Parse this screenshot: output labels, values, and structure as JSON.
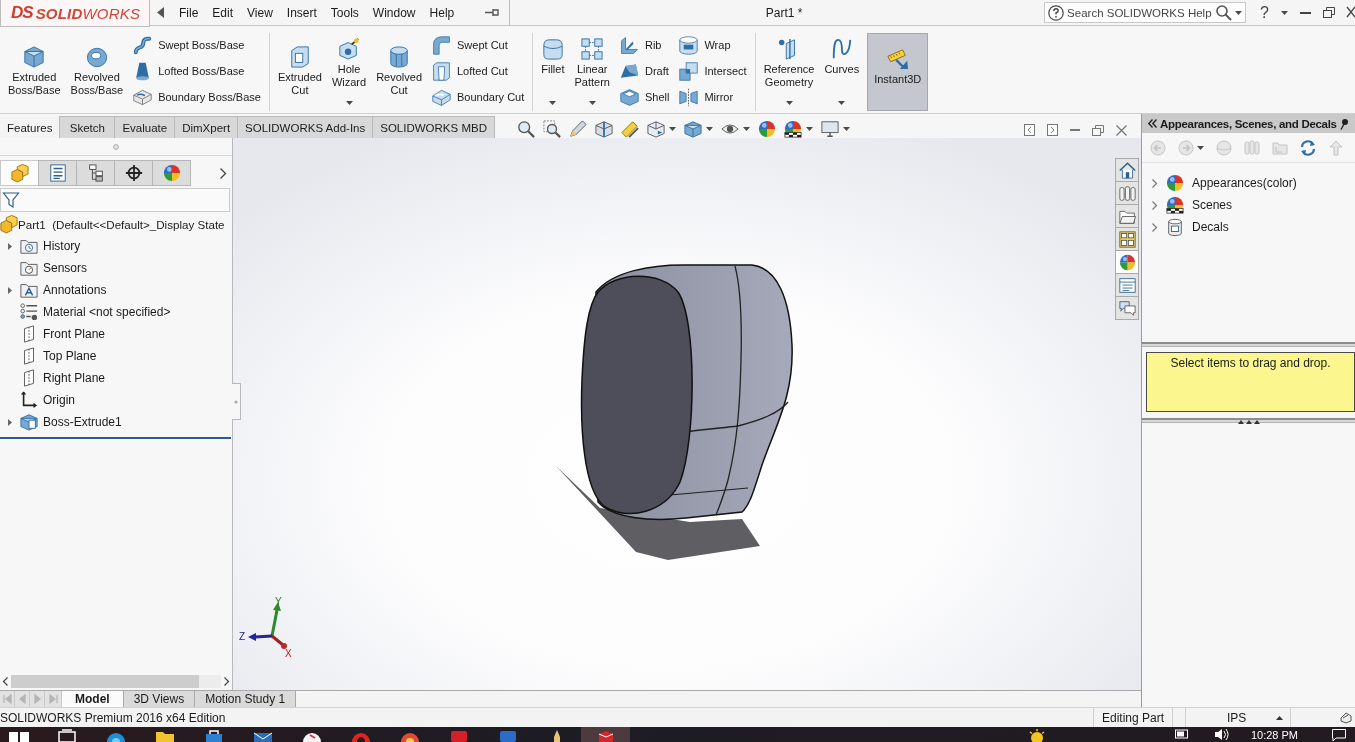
{
  "title_bar": {
    "logo": {
      "mark": "DS",
      "wordmark": "**SOLID**WORKS"
    },
    "menus": [
      "File",
      "Edit",
      "View",
      "Insert",
      "Tools",
      "Window",
      "Help"
    ],
    "document_title": "Part1 *",
    "search": {
      "placeholder": "Search SOLIDWORKS Help"
    },
    "help_glyph": "?"
  },
  "ribbon": {
    "groups": [
      {
        "items": [
          {
            "kind": "large",
            "label": "Extruded Boss/Base",
            "dropdown": false,
            "on": false
          },
          {
            "kind": "large",
            "label": "Revolved Boss/Base",
            "dropdown": false,
            "on": false
          },
          {
            "kind": "stack",
            "items": [
              "Swept Boss/Base",
              "Lofted Boss/Base",
              "Boundary Boss/Base"
            ]
          }
        ]
      },
      {
        "items": [
          {
            "kind": "large",
            "label": "Extruded Cut",
            "dropdown": false,
            "on": false
          },
          {
            "kind": "large",
            "label": "Hole Wizard",
            "dropdown": true,
            "on": false
          },
          {
            "kind": "large",
            "label": "Revolved Cut",
            "dropdown": false,
            "on": false
          },
          {
            "kind": "stack",
            "items": [
              "Swept Cut",
              "Lofted Cut",
              "Boundary Cut"
            ]
          }
        ]
      },
      {
        "items": [
          {
            "kind": "large",
            "label": "Fillet",
            "dropdown": true,
            "on": false
          },
          {
            "kind": "large",
            "label": "Linear Pattern",
            "dropdown": true,
            "on": false
          },
          {
            "kind": "stack",
            "items": [
              "Rib",
              "Draft",
              "Shell"
            ]
          },
          {
            "kind": "stack",
            "items": [
              "Wrap",
              "Intersect",
              "Mirror"
            ]
          }
        ]
      },
      {
        "items": [
          {
            "kind": "large",
            "label": "Reference Geometry",
            "dropdown": true,
            "on": false
          },
          {
            "kind": "large",
            "label": "Curves",
            "dropdown": true,
            "on": false
          },
          {
            "kind": "large",
            "label": "Instant3D",
            "dropdown": false,
            "on": true
          }
        ]
      }
    ]
  },
  "command_tabs": [
    {
      "label": "Features",
      "selected": true
    },
    {
      "label": "Sketch",
      "selected": false
    },
    {
      "label": "Evaluate",
      "selected": false
    },
    {
      "label": "DimXpert",
      "selected": false
    },
    {
      "label": "SOLIDWORKS Add-Ins",
      "selected": false
    },
    {
      "label": "SOLIDWORKS MBD",
      "selected": false
    }
  ],
  "feature_manager": {
    "tabs": [
      {
        "selected": true
      },
      {
        "selected": false
      },
      {
        "selected": false
      },
      {
        "selected": false
      },
      {
        "selected": false
      }
    ],
    "root": "Part1  (Default<<Default>_Display State",
    "items": [
      {
        "kind": "history",
        "label": "History",
        "expandable": true
      },
      {
        "kind": "sensors",
        "label": "Sensors",
        "expandable": false
      },
      {
        "kind": "annotations",
        "label": "Annotations",
        "expandable": true
      },
      {
        "kind": "material",
        "label": "Material <not specified>",
        "expandable": false
      },
      {
        "kind": "plane",
        "label": "Front Plane",
        "expandable": false
      },
      {
        "kind": "plane",
        "label": "Top Plane",
        "expandable": false
      },
      {
        "kind": "plane",
        "label": "Right Plane",
        "expandable": false
      },
      {
        "kind": "origin",
        "label": "Origin",
        "expandable": false
      },
      {
        "kind": "feature",
        "label": "Boss-Extrude1",
        "expandable": true
      }
    ]
  },
  "viewport": {
    "triad": {
      "y": "Y",
      "z": "Z",
      "x": "X"
    }
  },
  "task_pane": {
    "tabs": [
      {
        "selected": false
      },
      {
        "selected": false
      },
      {
        "selected": false
      },
      {
        "selected": false
      },
      {
        "selected": true
      },
      {
        "selected": false
      },
      {
        "selected": false
      }
    ],
    "title": "Appearances, Scenes, and Decals",
    "toolbar": [
      {
        "disabled": true
      },
      {
        "disabled": true
      },
      {
        "disabled": true
      },
      {
        "disabled": true
      },
      {
        "disabled": true
      },
      {
        "disabled": false
      },
      {
        "disabled": true
      }
    ],
    "tree": [
      {
        "kind": "appearances",
        "label": "Appearances(color)",
        "expandable": true
      },
      {
        "kind": "scenes",
        "label": "Scenes",
        "expandable": true
      },
      {
        "kind": "decals",
        "label": "Decals",
        "expandable": true
      }
    ],
    "hint": "Select items to drag and drop."
  },
  "bottom_nav": [
    {
      "disabled": true
    },
    {
      "disabled": true
    },
    {
      "disabled": true
    },
    {
      "disabled": true
    }
  ],
  "bottom_tabs": [
    {
      "label": "Model",
      "selected": true
    },
    {
      "label": "3D Views",
      "selected": false
    },
    {
      "label": "Motion Study 1",
      "selected": false
    }
  ],
  "status_bar": {
    "edition": "SOLIDWORKS Premium 2016 x64 Edition",
    "mode": "Editing Part",
    "units": "IPS"
  },
  "taskbar": {
    "clock": "10:28 PM"
  }
}
